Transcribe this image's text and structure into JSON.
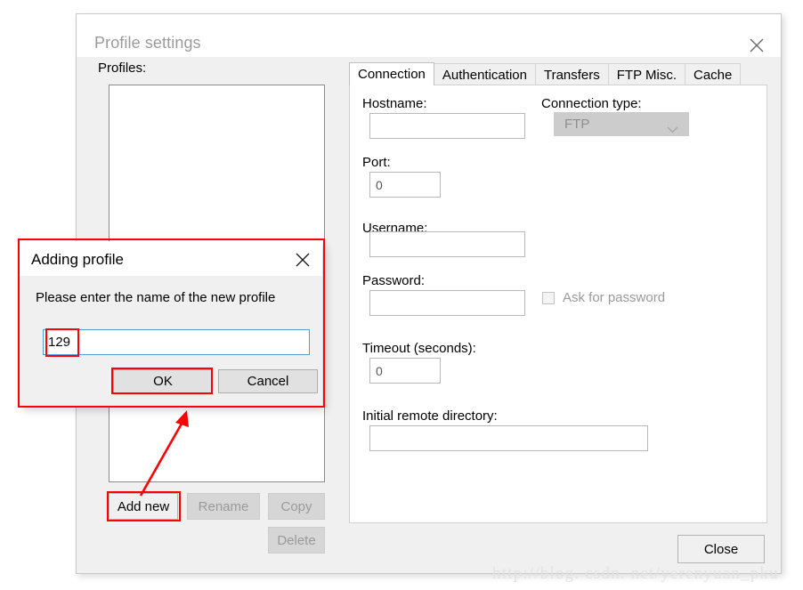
{
  "window": {
    "title": "Profile settings",
    "close_icon": "close-icon"
  },
  "left_pane": {
    "profiles_label": "Profiles:",
    "buttons": {
      "add_new": "Add new",
      "rename": "Rename",
      "copy": "Copy",
      "delete": "Delete"
    }
  },
  "tabs": [
    {
      "label": "Connection",
      "active": true
    },
    {
      "label": "Authentication",
      "active": false
    },
    {
      "label": "Transfers",
      "active": false
    },
    {
      "label": "FTP Misc.",
      "active": false
    },
    {
      "label": "Cache",
      "active": false
    }
  ],
  "connection_tab": {
    "hostname": {
      "label": "Hostname:",
      "value": "",
      "placeholder": ""
    },
    "connection_type": {
      "label": "Connection type:",
      "value": "FTP",
      "options": [
        "FTP"
      ],
      "chevron_icon": "chevron-down-icon"
    },
    "port": {
      "label": "Port:",
      "value": "0"
    },
    "username": {
      "label": "Username:",
      "value": ""
    },
    "password": {
      "label": "Password:",
      "value": ""
    },
    "ask_for_password": {
      "label": "Ask for password",
      "checked": false
    },
    "timeout": {
      "label": "Timeout (seconds):",
      "value": "0"
    },
    "initial_remote_directory": {
      "label": "Initial remote directory:",
      "value": ""
    }
  },
  "footer": {
    "close_button": "Close"
  },
  "modal": {
    "title": "Adding profile",
    "close_icon": "close-icon",
    "prompt": "Please enter the name of the new profile",
    "input_value": "129",
    "ok_button": "OK",
    "cancel_button": "Cancel"
  },
  "annotations": {
    "color": "#ff0000",
    "arrow_icon": "arrow-up-icon"
  },
  "watermark": "http://blog. csdn. net/yerenyuan_pku"
}
